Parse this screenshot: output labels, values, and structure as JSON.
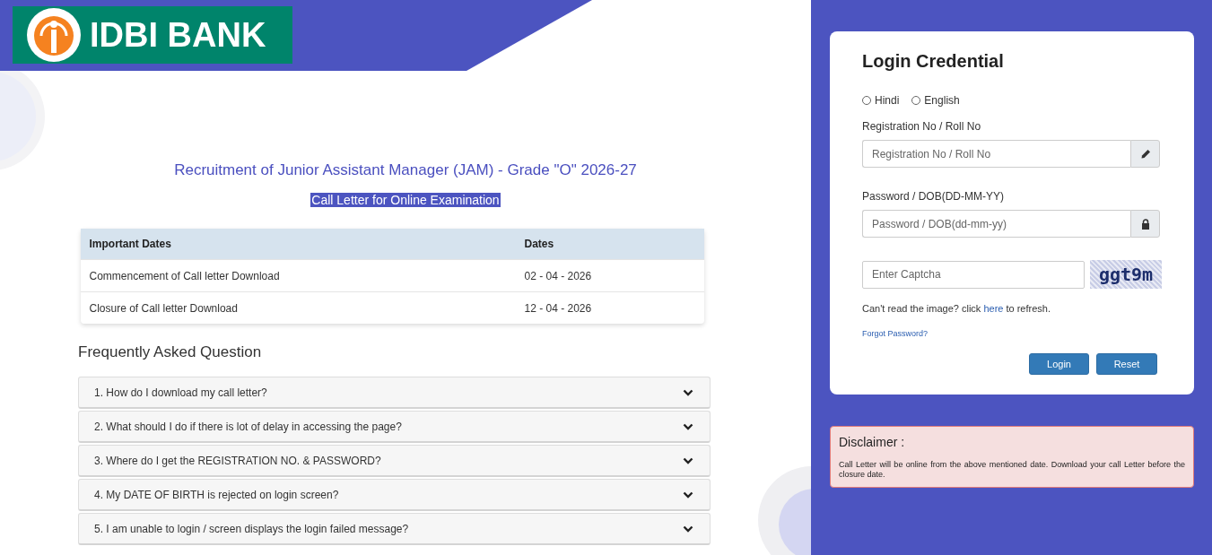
{
  "logo": {
    "text": "IDBI BANK"
  },
  "title": "Recruitment of Junior Assistant Manager (JAM) - Grade \"O\" 2026-27",
  "subtitle": "Call Letter for Online Examination",
  "dates_table": {
    "columns": [
      "Important Dates",
      "Dates"
    ],
    "rows": [
      [
        "Commencement of Call letter Download",
        "02 - 04 - 2026"
      ],
      [
        "Closure of Call letter Download",
        "12 - 04 - 2026"
      ]
    ]
  },
  "faq": {
    "heading": "Frequently Asked Question",
    "items": [
      {
        "question": "1. How do I download my call letter?",
        "expanded": false
      },
      {
        "question": "2. What should I do if there is lot of delay in accessing the page?",
        "expanded": false
      },
      {
        "question": "3. Where do I get the REGISTRATION NO. & PASSWORD?",
        "expanded": false
      },
      {
        "question": "4. My DATE OF BIRTH is rejected on login screen?",
        "expanded": false
      },
      {
        "question": "5. I am unable to login / screen displays the login failed message?",
        "expanded": false
      }
    ]
  },
  "login": {
    "title": "Login Credential",
    "languages": [
      {
        "label": "Hindi",
        "selected": false
      },
      {
        "label": "English",
        "selected": false
      }
    ],
    "fields": [
      {
        "label": "Registration No / Roll No",
        "placeholder": "Registration No / Roll No",
        "kind": "pencil"
      },
      {
        "label": "Password / DOB(DD-MM-YY)",
        "placeholder": "Password / DOB(dd-mm-yy)",
        "kind": "lock"
      }
    ],
    "captcha": {
      "placeholder": "Enter Captcha",
      "image_text": "ggt9m"
    },
    "refresh_note": {
      "before": "Can't read the image? click ",
      "link": "here",
      "after": " to refresh."
    },
    "forgot_link": "Forgot Password?",
    "buttons": [
      "Login",
      "Reset"
    ]
  },
  "disclaimer": {
    "title": "Disclaimer :",
    "text": "Call Letter will be online from the above mentioned date. Download your call Letter before the closure date."
  }
}
